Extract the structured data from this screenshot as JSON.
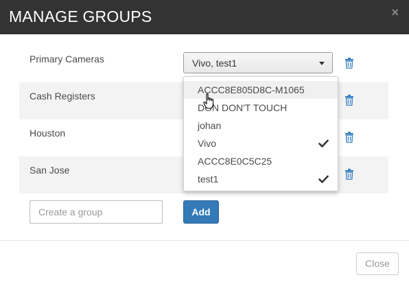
{
  "modal": {
    "title": "MANAGE GROUPS",
    "close_glyph": "×"
  },
  "groups": [
    {
      "label": "Primary Cameras"
    },
    {
      "label": "Cash Registers"
    },
    {
      "label": "Houston"
    },
    {
      "label": "San Jose"
    }
  ],
  "select": {
    "value": "Vivo, test1",
    "options": [
      {
        "label": "ACCC8E805D8C-M1065",
        "checked": false,
        "hovered": true
      },
      {
        "label": "DON DON'T TOUCH",
        "checked": false,
        "hovered": false
      },
      {
        "label": "johan",
        "checked": false,
        "hovered": false
      },
      {
        "label": "Vivo",
        "checked": true,
        "hovered": false
      },
      {
        "label": "ACCC8E0C5C25",
        "checked": false,
        "hovered": false
      },
      {
        "label": "test1",
        "checked": true,
        "hovered": false
      }
    ]
  },
  "create": {
    "placeholder": "Create a group",
    "value": "",
    "add_label": "Add"
  },
  "footer": {
    "close_label": "Close"
  },
  "icons": {
    "trash": "trash-icon",
    "check": "check-icon",
    "caret": "caret-down-icon",
    "cursor": "hand-pointer-icon"
  },
  "colors": {
    "header_bg": "#333333",
    "accent": "#337ab7",
    "icon_blue": "#3a84c4",
    "stripe": "#f3f3f3"
  }
}
